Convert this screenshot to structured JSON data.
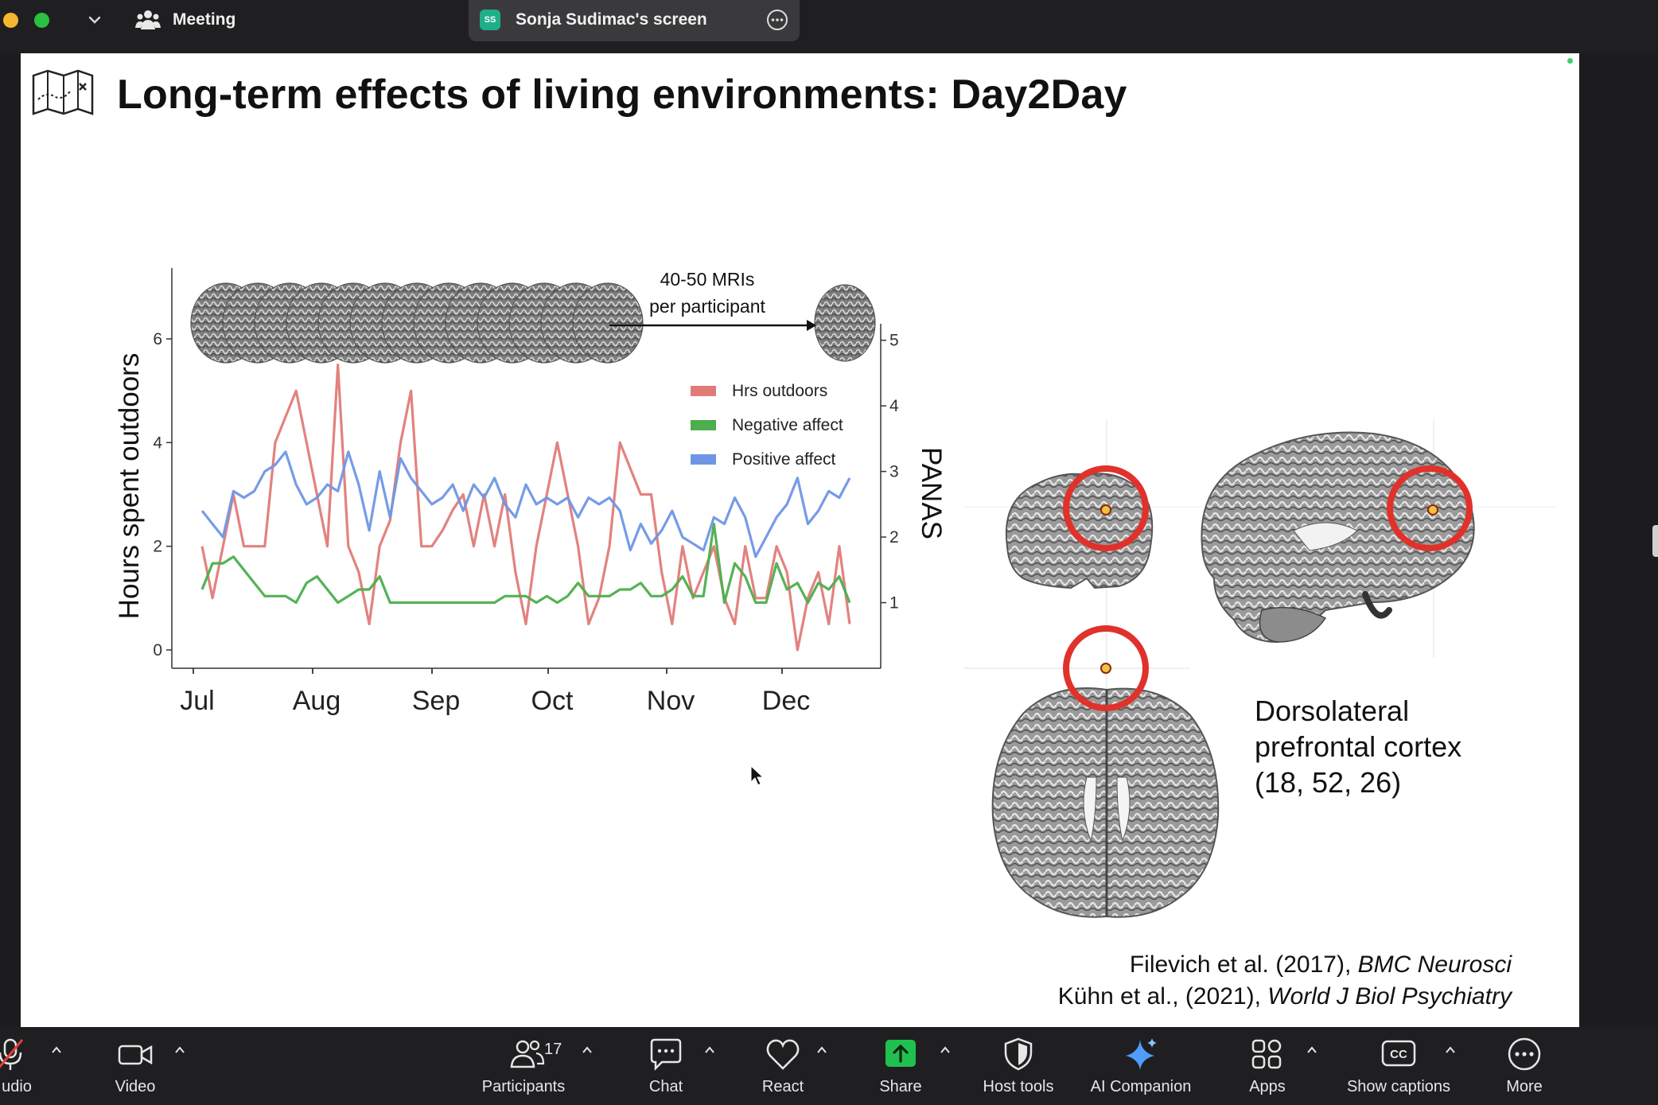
{
  "topbar": {
    "meeting_label": "Meeting",
    "screen_badge": "SS",
    "screen_label": "Sonja Sudimac's screen",
    "colors": {
      "close": "#f5b731",
      "zoom": "#29c13f",
      "badge": "#1fae8a"
    }
  },
  "slide": {
    "title": "Long-term effects of living environments: Day2Day",
    "mri_label_line1": "40-50 MRIs",
    "mri_label_line2": "per participant",
    "brain_caption": [
      "Dorsolateral",
      "prefrontal cortex",
      "(18, 52, 26)"
    ],
    "citation1_plain": "Filevich et al. (2017), ",
    "citation1_italic": "BMC Neurosci",
    "citation2_plain": "Kühn et al., (2021), ",
    "citation2_italic": "World J Biol Psychiatry"
  },
  "chart_data": {
    "type": "line",
    "x_ticks": [
      "Jul",
      "Aug",
      "Sep",
      "Oct",
      "Nov",
      "Dec"
    ],
    "ylabel_left": "Hours spent outdoors",
    "ylabel_right": "PANAS",
    "y_left_ticks": [
      "0",
      "2",
      "4",
      "6"
    ],
    "y_left_range": [
      0,
      6
    ],
    "y_right_ticks": [
      "1",
      "2",
      "3",
      "4",
      "5"
    ],
    "y_right_range": [
      0.0,
      6.1
    ],
    "legend_position": "top-right",
    "series": [
      {
        "name": "Hrs outdoors",
        "axis": "left",
        "color": "#e07b78",
        "values": [
          2.0,
          1.0,
          2.0,
          3.0,
          2.0,
          2.0,
          2.0,
          4.0,
          4.5,
          5.0,
          4.0,
          3.0,
          2.0,
          5.5,
          2.0,
          1.5,
          0.5,
          2.0,
          2.5,
          4.0,
          5.0,
          2.0,
          2.0,
          2.3,
          2.7,
          3.0,
          2.0,
          3.0,
          2.0,
          3.0,
          1.5,
          0.5,
          2.0,
          3.0,
          4.0,
          3.0,
          2.0,
          0.5,
          1.0,
          2.0,
          4.0,
          3.5,
          3.0,
          3.0,
          1.5,
          0.5,
          2.0,
          1.0,
          1.5,
          2.0,
          1.0,
          0.5,
          2.0,
          1.0,
          1.0,
          2.0,
          1.5,
          0.0,
          1.0,
          1.5,
          0.5,
          2.0,
          0.5
        ]
      },
      {
        "name": "Negative affect",
        "axis": "right",
        "color": "#4cae4c",
        "values": [
          1.2,
          1.6,
          1.6,
          1.7,
          1.5,
          1.3,
          1.1,
          1.1,
          1.1,
          1.0,
          1.3,
          1.4,
          1.2,
          1.0,
          1.1,
          1.2,
          1.2,
          1.4,
          1.0,
          1.0,
          1.0,
          1.0,
          1.0,
          1.0,
          1.0,
          1.0,
          1.0,
          1.0,
          1.0,
          1.1,
          1.1,
          1.1,
          1.0,
          1.1,
          1.0,
          1.1,
          1.3,
          1.1,
          1.1,
          1.1,
          1.2,
          1.2,
          1.3,
          1.1,
          1.1,
          1.2,
          1.4,
          1.1,
          1.1,
          2.2,
          1.0,
          1.6,
          1.4,
          1.0,
          1.0,
          1.6,
          1.2,
          1.3,
          1.0,
          1.3,
          1.2,
          1.4,
          1.0
        ]
      },
      {
        "name": "Positive affect",
        "axis": "right",
        "color": "#6f96e6",
        "values": [
          2.4,
          2.2,
          2.0,
          2.7,
          2.6,
          2.7,
          3.0,
          3.1,
          3.3,
          2.8,
          2.5,
          2.6,
          2.8,
          2.7,
          3.3,
          2.8,
          2.1,
          3.0,
          2.3,
          3.2,
          2.9,
          2.7,
          2.5,
          2.6,
          2.8,
          2.4,
          2.8,
          2.6,
          2.9,
          2.5,
          2.3,
          2.8,
          2.5,
          2.6,
          2.5,
          2.6,
          2.3,
          2.6,
          2.5,
          2.6,
          2.4,
          1.8,
          2.2,
          1.9,
          2.1,
          2.4,
          2.0,
          1.9,
          1.8,
          2.3,
          2.2,
          2.6,
          2.3,
          1.7,
          2.0,
          2.3,
          2.5,
          2.9,
          2.2,
          2.4,
          2.7,
          2.6,
          2.9
        ]
      }
    ]
  },
  "bottombar": {
    "items": [
      {
        "key": "audio",
        "label": "udio",
        "icon": "microphone-muted-icon"
      },
      {
        "key": "video",
        "label": "Video",
        "icon": "video-camera-icon"
      },
      {
        "key": "participants",
        "label": "Participants",
        "icon": "participants-icon",
        "count": "17"
      },
      {
        "key": "chat",
        "label": "Chat",
        "icon": "chat-bubble-icon"
      },
      {
        "key": "react",
        "label": "React",
        "icon": "heart-icon"
      },
      {
        "key": "share",
        "label": "Share",
        "icon": "share-arrow-icon"
      },
      {
        "key": "host_tools",
        "label": "Host tools",
        "icon": "shield-icon"
      },
      {
        "key": "ai_companion",
        "label": "AI Companion",
        "icon": "sparkle-icon"
      },
      {
        "key": "apps",
        "label": "Apps",
        "icon": "apps-icon"
      },
      {
        "key": "captions",
        "label": "Show captions",
        "icon": "cc-icon"
      },
      {
        "key": "more",
        "label": "More",
        "icon": "more-dots-icon"
      }
    ],
    "colors": {
      "share": "#20c050",
      "muted_slash": "#e0403a",
      "ai": "#5aa8ff"
    }
  }
}
